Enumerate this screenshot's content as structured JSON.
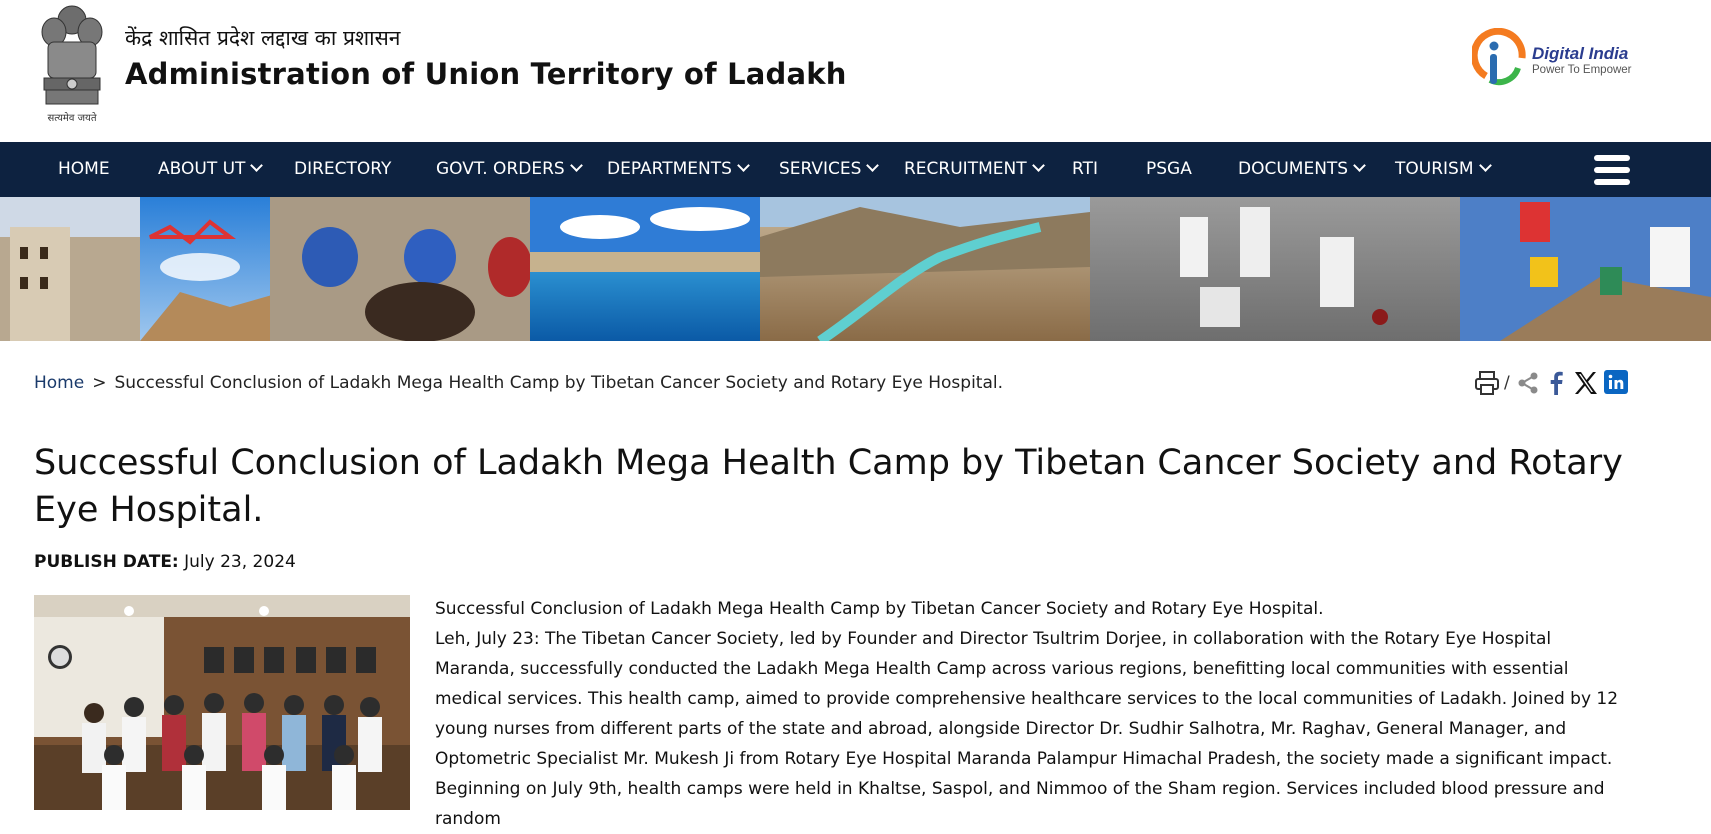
{
  "header": {
    "emblem_caption": "सत्यमेव जयते",
    "title_hindi": "केंद्र शासित प्रदेश लद्दाख का प्रशासन",
    "title_english": "Administration of Union Territory of Ladakh",
    "digital_india": {
      "title": "Digital India",
      "tagline": "Power To Empower"
    }
  },
  "nav": {
    "items": [
      {
        "label": "HOME",
        "dropdown": false
      },
      {
        "label": "ABOUT UT",
        "dropdown": true
      },
      {
        "label": "DIRECTORY",
        "dropdown": false
      },
      {
        "label": "GOVT. ORDERS",
        "dropdown": true
      },
      {
        "label": "DEPARTMENTS",
        "dropdown": true
      },
      {
        "label": "SERVICES",
        "dropdown": true
      },
      {
        "label": "RECRUITMENT",
        "dropdown": true
      },
      {
        "label": "RTI",
        "dropdown": false
      },
      {
        "label": "PSGA",
        "dropdown": false
      },
      {
        "label": "DOCUMENTS",
        "dropdown": true
      },
      {
        "label": "TOURISM",
        "dropdown": true
      }
    ]
  },
  "breadcrumb": {
    "home": "Home",
    "separator": ">",
    "current": "Successful Conclusion of Ladakh Mega Health Camp by Tibetan Cancer Society and Rotary Eye Hospital."
  },
  "share": {
    "separator": "/"
  },
  "article": {
    "title": "Successful Conclusion of Ladakh Mega Health Camp by Tibetan Cancer Society and Rotary Eye Hospital.",
    "publish_label": "PUBLISH DATE:",
    "publish_date": "July 23, 2024",
    "paragraphs": [
      "Successful Conclusion of Ladakh Mega Health Camp by Tibetan Cancer Society and Rotary Eye Hospital.",
      "Leh, July 23: The Tibetan Cancer Society, led by Founder and Director Tsultrim Dorjee, in collaboration with the Rotary Eye Hospital Maranda, successfully conducted the Ladakh Mega Health Camp across various regions, benefitting local communities with essential medical services. This health camp, aimed to provide comprehensive healthcare services to the local communities of Ladakh. Joined by 12 young nurses from different parts of the state and abroad, alongside Director Dr. Sudhir Salhotra, Mr. Raghav, General Manager, and Optometric Specialist Mr. Mukesh Ji from Rotary Eye Hospital Maranda Palampur Himachal Pradesh, the society made a significant impact.",
      "Beginning on July 9th, health camps were held in Khaltse, Saspol, and Nimmoo of the Sham region. Services included blood pressure and random"
    ]
  },
  "colors": {
    "nav_bg": "#0d2240",
    "link": "#1a3a6b",
    "facebook": "#3b5998",
    "linkedin": "#0a66c2"
  }
}
